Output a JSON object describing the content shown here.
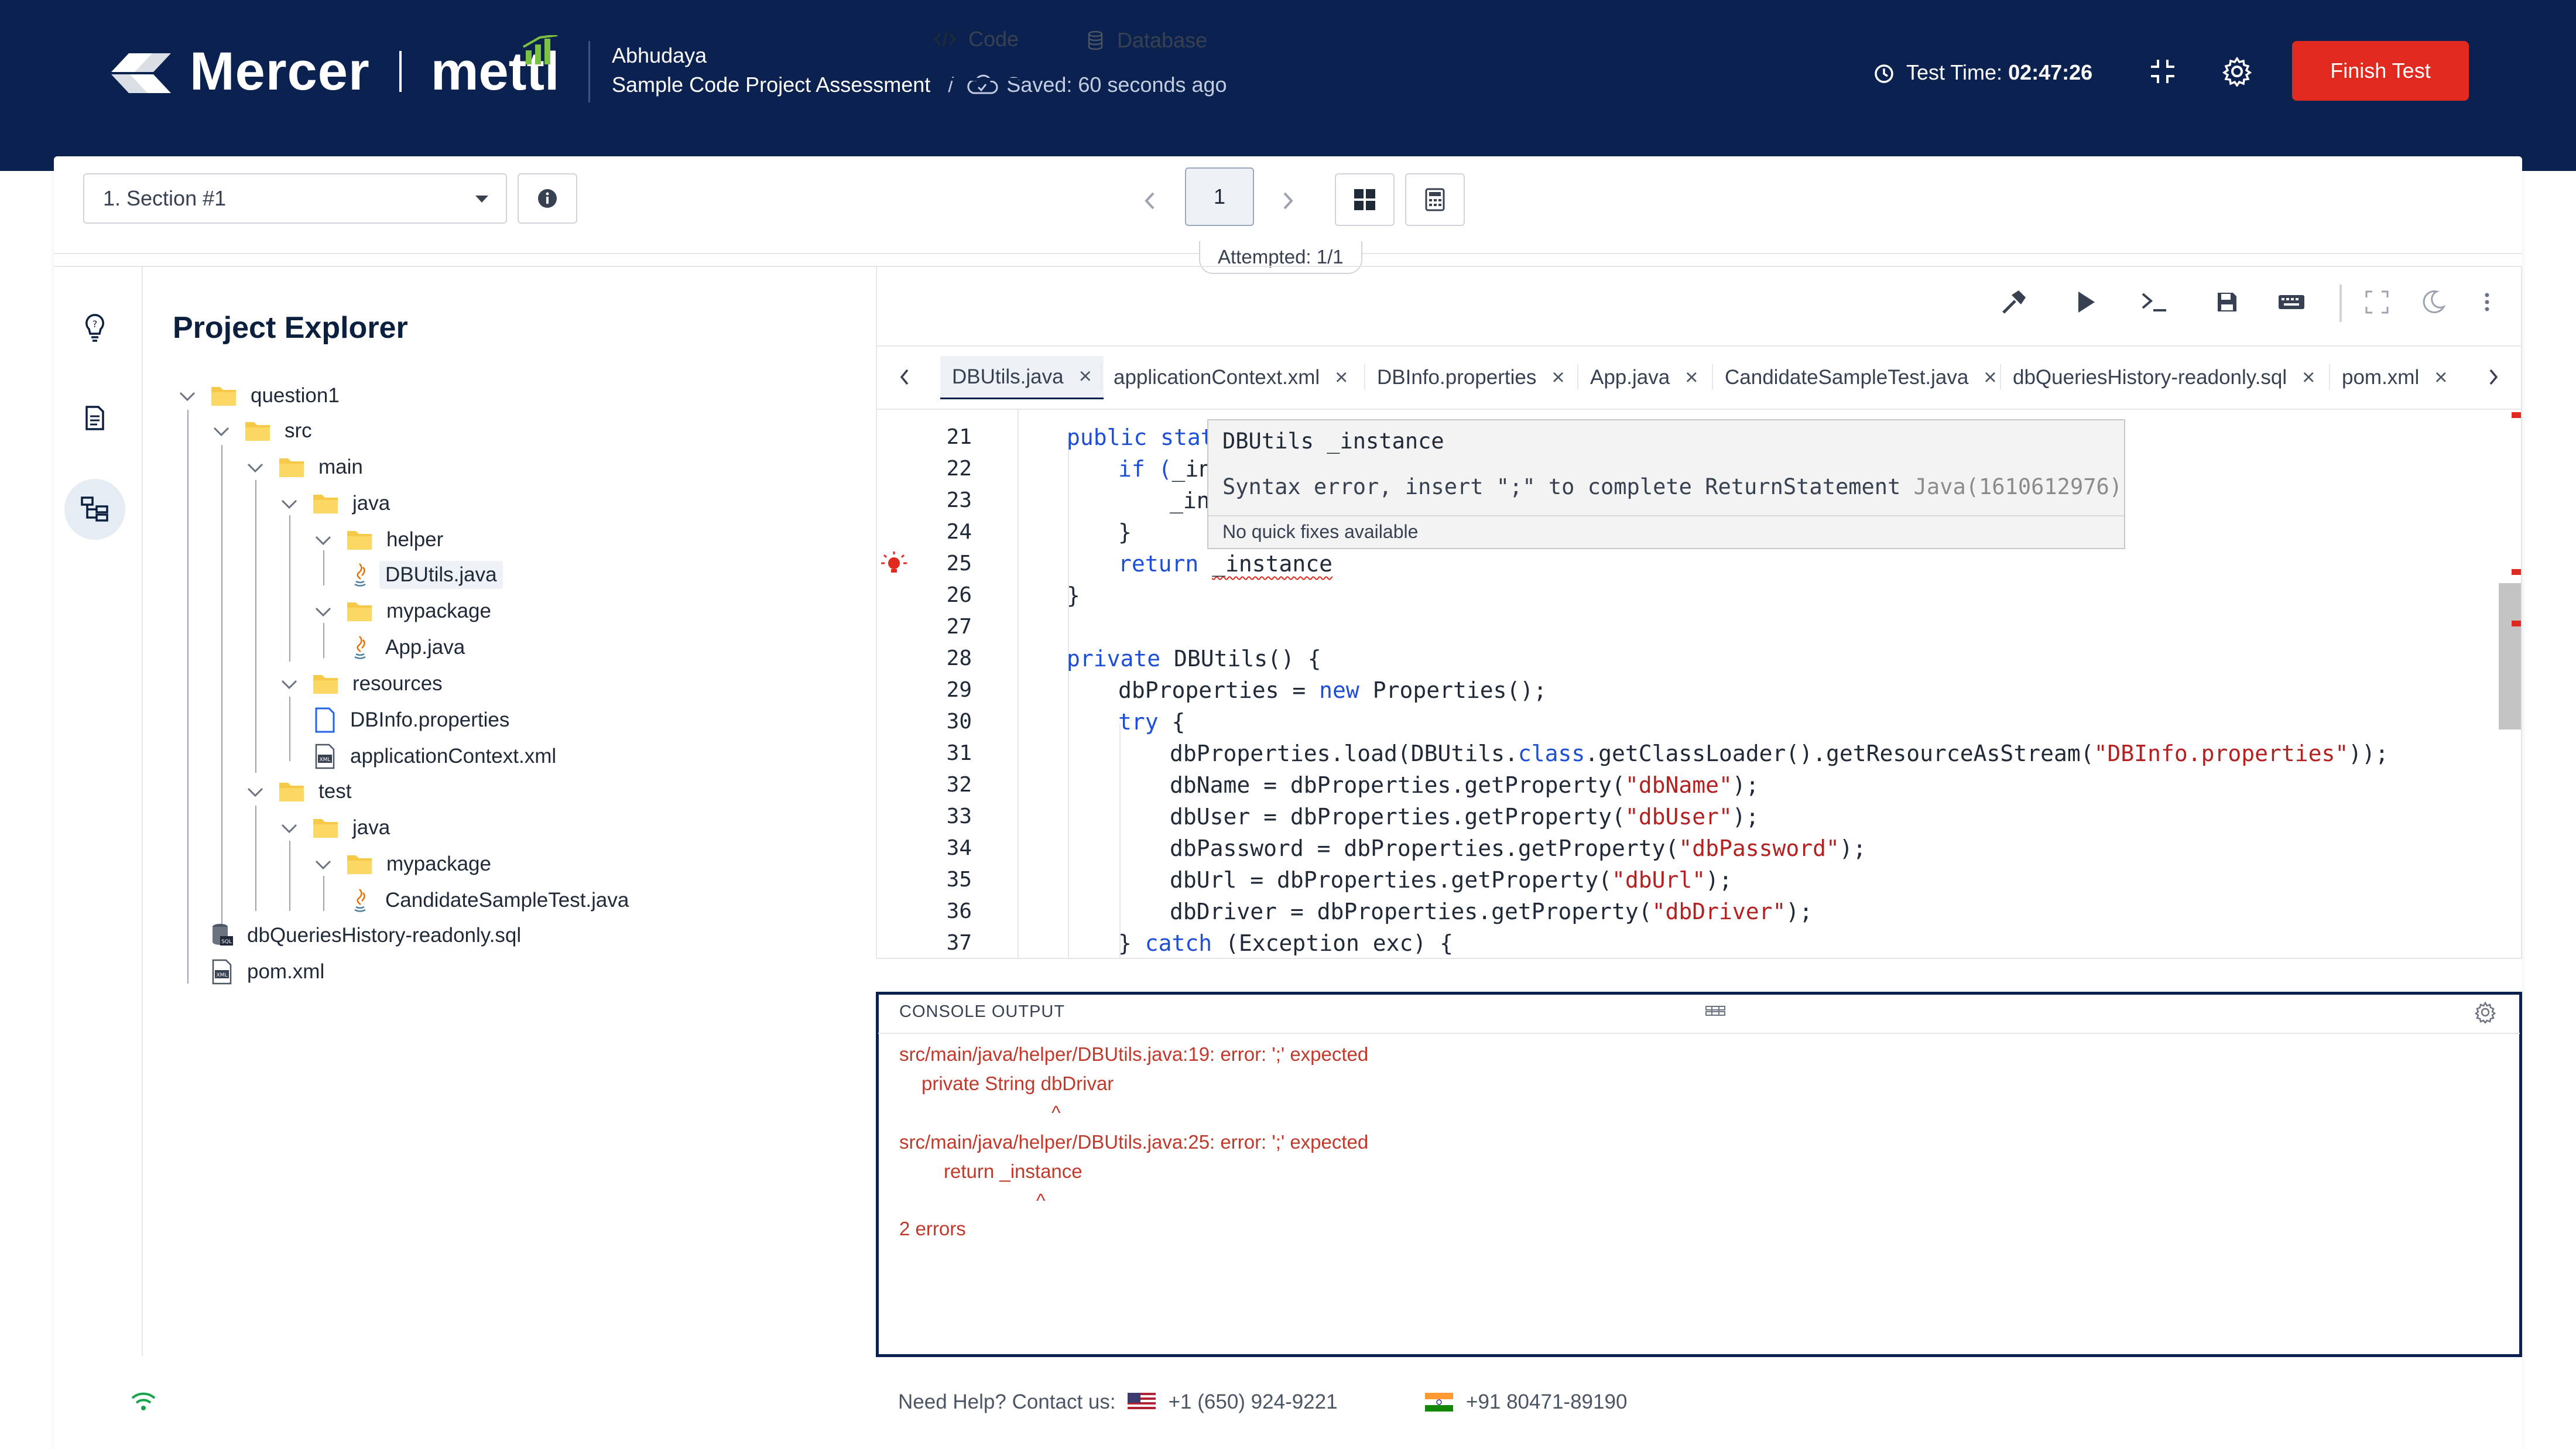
{
  "header": {
    "brand_mercer": "Mercer",
    "brand_mettl": "mettl",
    "candidate_name": "Abhudaya",
    "assessment_name": "Sample Code Project Assessment",
    "separator": "/",
    "saved_status": "Saved: 60 seconds ago",
    "test_time_label": "Test Time:",
    "test_time_value": "02:47:26",
    "finish_label": "Finish Test",
    "colors": {
      "header_bg": "#0b2150",
      "finish_bg": "#e02a1f"
    }
  },
  "toolbar": {
    "section_selected": "1. Section #1",
    "current_page": "1",
    "attempted": "Attempted: 1/1"
  },
  "explorer": {
    "title": "Project Explorer",
    "items": [
      {
        "label": "question1",
        "type": "folder"
      },
      {
        "label": "src",
        "type": "folder"
      },
      {
        "label": "main",
        "type": "folder"
      },
      {
        "label": "java",
        "type": "folder"
      },
      {
        "label": "helper",
        "type": "folder"
      },
      {
        "label": "DBUtils.java",
        "type": "java-file",
        "selected": true
      },
      {
        "label": "mypackage",
        "type": "folder"
      },
      {
        "label": "App.java",
        "type": "java-file"
      },
      {
        "label": "resources",
        "type": "folder"
      },
      {
        "label": "DBInfo.properties",
        "type": "file"
      },
      {
        "label": "applicationContext.xml",
        "type": "xml-file"
      },
      {
        "label": "test",
        "type": "folder"
      },
      {
        "label": "java",
        "type": "folder"
      },
      {
        "label": "mypackage",
        "type": "folder"
      },
      {
        "label": "CandidateSampleTest.java",
        "type": "java-file"
      },
      {
        "label": "dbQueriesHistory-readonly.sql",
        "type": "sql-file"
      },
      {
        "label": "pom.xml",
        "type": "xml-file"
      }
    ]
  },
  "editor": {
    "tabs": [
      {
        "label": "Code",
        "active": true
      },
      {
        "label": "Database",
        "active": false
      }
    ],
    "file_tabs": [
      "DBUtils.java",
      "applicationContext.xml",
      "DBInfo.properties",
      "App.java",
      "CandidateSampleTest.java",
      "dbQueriesHistory-readonly.sql",
      "pom.xml"
    ],
    "line_numbers": [
      "21",
      "22",
      "23",
      "24",
      "25",
      "26",
      "27",
      "28",
      "29",
      "30",
      "31",
      "32",
      "33",
      "34",
      "35",
      "36",
      "37"
    ],
    "code": {
      "l21_kw": "public stat",
      "l22_a": "if (",
      "l22_b": "_in",
      "l23": "_in",
      "l24": "}",
      "l25_kw": "return ",
      "l25_id": "_instance",
      "l26": "}",
      "l28_kw": "private ",
      "l28_rest": "DBUtils() {",
      "l29_a": "dbProperties = ",
      "l29_kw": "new ",
      "l29_b": "Properties();",
      "l30_kw": "try ",
      "l30_b": "{",
      "l31_a": "dbProperties.load(DBUtils.",
      "l31_kw": "class",
      "l31_b": ".getClassLoader().getResourceAsStream(",
      "l31_str": "\"DBInfo.properties\"",
      "l31_c": "));",
      "l32_a": "dbName = dbProperties.getProperty(",
      "l32_str": "\"dbName\"",
      "l32_c": ");",
      "l33_a": "dbUser = dbProperties.getProperty(",
      "l33_str": "\"dbUser\"",
      "l33_c": ");",
      "l34_a": "dbPassword = dbProperties.getProperty(",
      "l34_str": "\"dbPassword\"",
      "l34_c": ");",
      "l35_a": "dbUrl = dbProperties.getProperty(",
      "l35_str": "\"dbUrl\"",
      "l35_c": ");",
      "l36_a": "dbDriver = dbProperties.getProperty(",
      "l36_str": "\"dbDriver\"",
      "l36_c": ");",
      "l37_a": "} ",
      "l37_kw": "catch ",
      "l37_b": "(Exception exc) {"
    },
    "hover": {
      "title": "DBUtils _instance",
      "error": "Syntax error, insert \";\" to complete ReturnStatement",
      "error_code": "Java(1610612976)",
      "no_fix": "No quick fixes available"
    }
  },
  "console": {
    "title": "CONSOLE OUTPUT",
    "lines": [
      "src/main/java/helper/DBUtils.java:19: error: ';' expected",
      "private String dbDrivar",
      "^",
      "src/main/java/helper/DBUtils.java:25: error: ';' expected",
      "return _instance",
      "^",
      "2 errors"
    ]
  },
  "footer": {
    "help_label": "Need Help? Contact us:",
    "phone_us": "+1 (650) 924-9221",
    "phone_in": "+91 80471-89190"
  }
}
